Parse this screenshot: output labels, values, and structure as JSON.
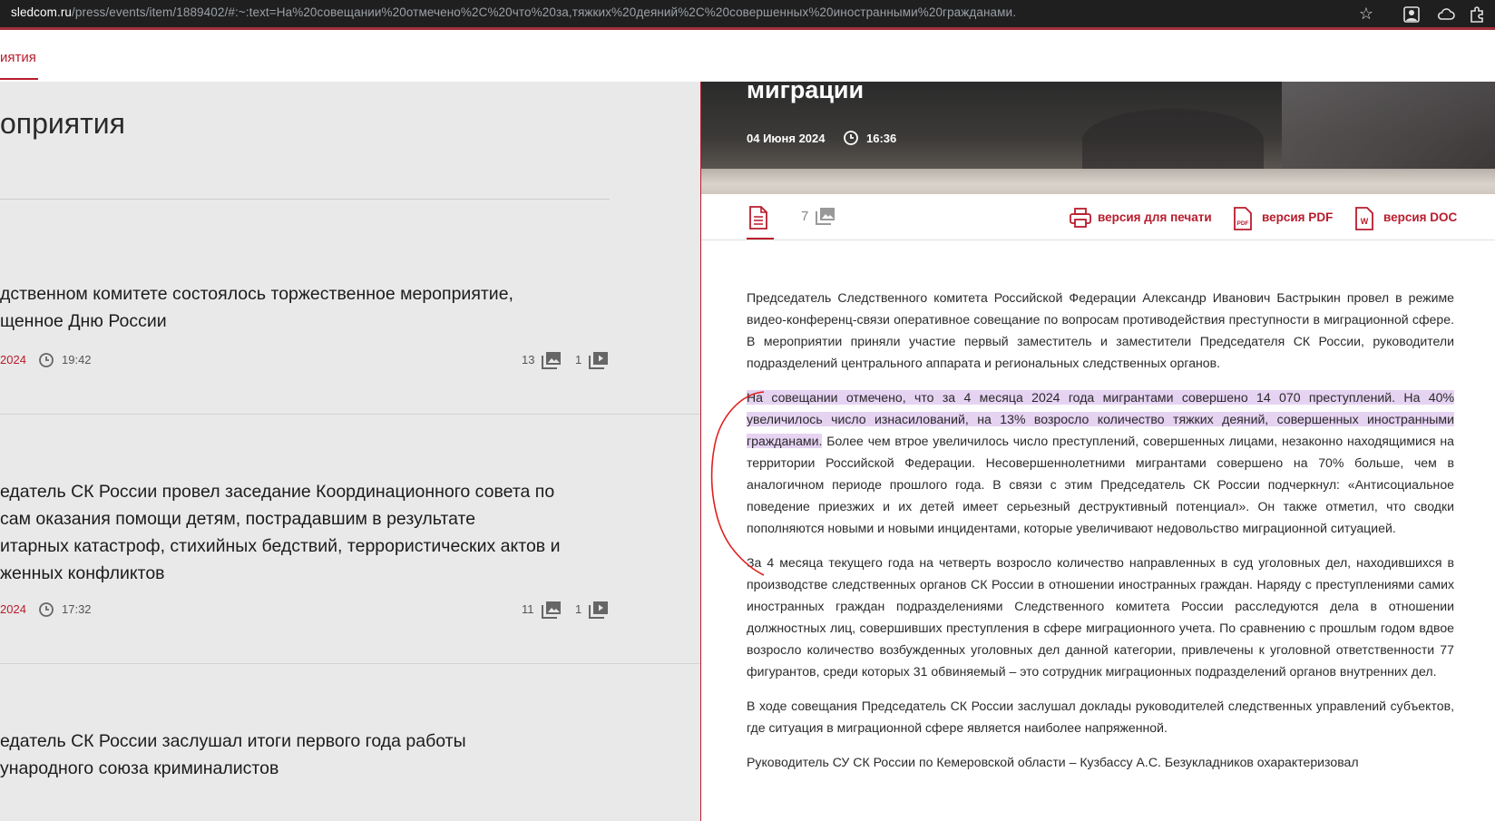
{
  "browser": {
    "url_domain": "sledcom.ru",
    "url_rest": "/press/events/item/1889402/#:~:text=На%20совещании%20отмечено%2C%20что%20за,тяжких%20деяний%2C%20совершенных%20иностранными%20гражданами."
  },
  "header": {
    "active_nav": "иятия"
  },
  "left": {
    "heading": "оприятия",
    "events": [
      {
        "title": "дственном комитете состоялось торжественное мероприятие, щенное Дню России",
        "line1": "дственном комитете состоялось торжественное мероприятие,",
        "line2": "щенное Дню России",
        "date": "2024",
        "time": "19:42",
        "photos": "13",
        "videos": "1"
      },
      {
        "line1": "едатель СК России провел заседание Координационного совета по",
        "line2": "сам оказания помощи детям, пострадавшим в результате",
        "line3": "итарных катастроф, стихийных бедствий, террористических актов и",
        "line4": "женных конфликтов",
        "date": "2024",
        "time": "17:32",
        "photos": "11",
        "videos": "1"
      },
      {
        "line1": "едатель СК России заслушал итоги первого года работы",
        "line2": "ународного союза криминалистов"
      }
    ]
  },
  "right": {
    "hero_title": "миграции",
    "hero_date": "04 Июня 2024",
    "hero_time": "16:36",
    "photo_count": "7",
    "print_label": "версия для печати",
    "pdf_label": "версия PDF",
    "doc_label": "версия DOC",
    "pdf_icon_text": "PDF",
    "doc_icon_text": "W",
    "p1": "Председатель Следственного комитета Российской Федерации Александр Иванович Бастрыкин провел в режиме видео-конференц-связи оперативное совещание по вопросам противодействия преступности в миграционной сфере. В мероприятии приняли участие первый заместитель и заместители Председателя СК России, руководители подразделений центрального аппарата и региональных следственных органов.",
    "p2_highlight": "На совещании отмечено, что за 4 месяца 2024 года мигрантами совершено 14 070 преступлений. На 40% увеличилось число изнасилований, на 13% возросло количество тяжких деяний, совершенных иностранными гражданами.",
    "p2_rest": " Более чем втрое увеличилось число преступлений, совершенных лицами, незаконно находящимися на территории Российской Федерации. Несовершеннолетними мигрантами совершено на 70% больше, чем в аналогичном периоде прошлого года. В связи с этим Председатель СК России подчеркнул: «Антисоциальное поведение приезжих и их детей имеет серьезный деструктивный потенциал». Он также отметил, что сводки пополняются новыми и новыми инцидентами, которые увеличивают недовольство миграционной ситуацией.",
    "p3": "За 4 месяца текущего года на четверть возросло количество направленных в суд уголовных дел, находившихся в производстве следственных органов СК России в отношении иностранных граждан. Наряду с преступлениями самих иностранных граждан подразделениями Следственного комитета России расследуются дела в отношении должностных лиц, совершивших преступления в сфере миграционного учета. По сравнению с прошлым годом вдвое возросло количество возбужденных уголовных дел данной категории, привлечены к уголовной ответственности 77 фигурантов, среди которых 31 обвиняемый – это сотрудник миграционных подразделений органов внутренних дел.",
    "p4": "В ходе совещания Председатель СК России заслушал доклады руководителей следственных управлений субъектов, где ситуация в миграционной сфере является наиболее напряженной.",
    "p5": "Руководитель СУ СК России по Кемеровской области – Кузбассу А.С. Безукладников охарактеризовал"
  },
  "colors": {
    "accent": "#b81c2c",
    "highlight": "#e6d3f2",
    "panel_bg": "#e9e9e9"
  }
}
